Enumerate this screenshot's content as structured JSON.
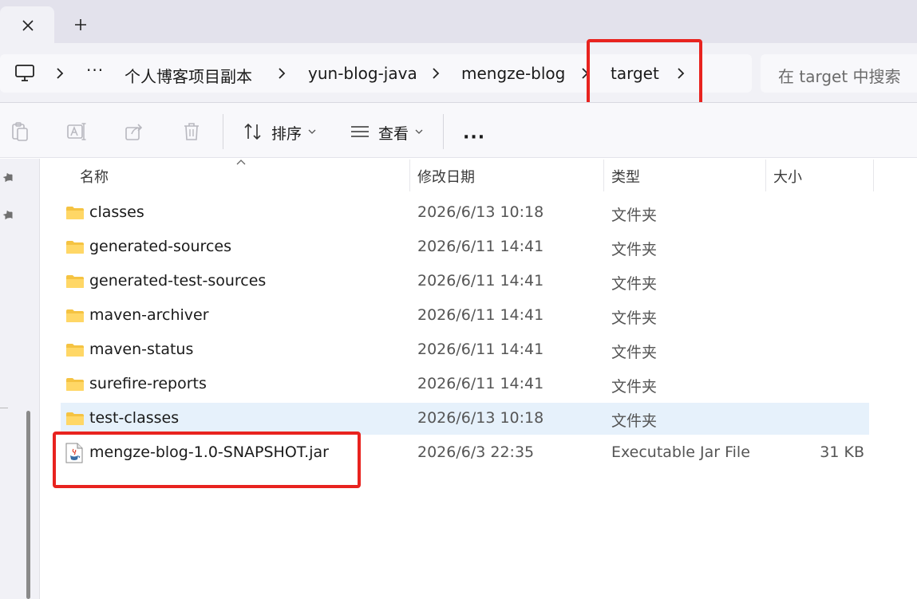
{
  "window": {
    "close_glyph": "✕",
    "new_tab_glyph": "+"
  },
  "address": {
    "overflow": "···",
    "breadcrumbs": [
      "个人博客项目副本",
      "yun-blog-java",
      "mengze-blog",
      "target"
    ],
    "search_placeholder": "在 target 中搜索"
  },
  "toolbar": {
    "sort_label": "排序",
    "view_label": "查看",
    "more_glyph": "···"
  },
  "columns": {
    "name": "名称",
    "date": "修改日期",
    "type": "类型",
    "size": "大小"
  },
  "files": [
    {
      "name": "classes",
      "date": "2026/6/13 10:18",
      "type": "文件夹",
      "size": "",
      "kind": "folder"
    },
    {
      "name": "generated-sources",
      "date": "2026/6/11 14:41",
      "type": "文件夹",
      "size": "",
      "kind": "folder"
    },
    {
      "name": "generated-test-sources",
      "date": "2026/6/11 14:41",
      "type": "文件夹",
      "size": "",
      "kind": "folder"
    },
    {
      "name": "maven-archiver",
      "date": "2026/6/11 14:41",
      "type": "文件夹",
      "size": "",
      "kind": "folder"
    },
    {
      "name": "maven-status",
      "date": "2026/6/11 14:41",
      "type": "文件夹",
      "size": "",
      "kind": "folder"
    },
    {
      "name": "surefire-reports",
      "date": "2026/6/11 14:41",
      "type": "文件夹",
      "size": "",
      "kind": "folder"
    },
    {
      "name": "test-classes",
      "date": "2026/6/13 10:18",
      "type": "文件夹",
      "size": "",
      "kind": "folder",
      "selected": true
    },
    {
      "name": "mengze-blog-1.0-SNAPSHOT.jar",
      "date": "2026/6/3 22:35",
      "type": "Executable Jar File",
      "size": "31 KB",
      "kind": "jar"
    }
  ],
  "colors": {
    "highlight": "#e8231f",
    "selection": "#e6f1fb",
    "folder": "#f5c342"
  }
}
